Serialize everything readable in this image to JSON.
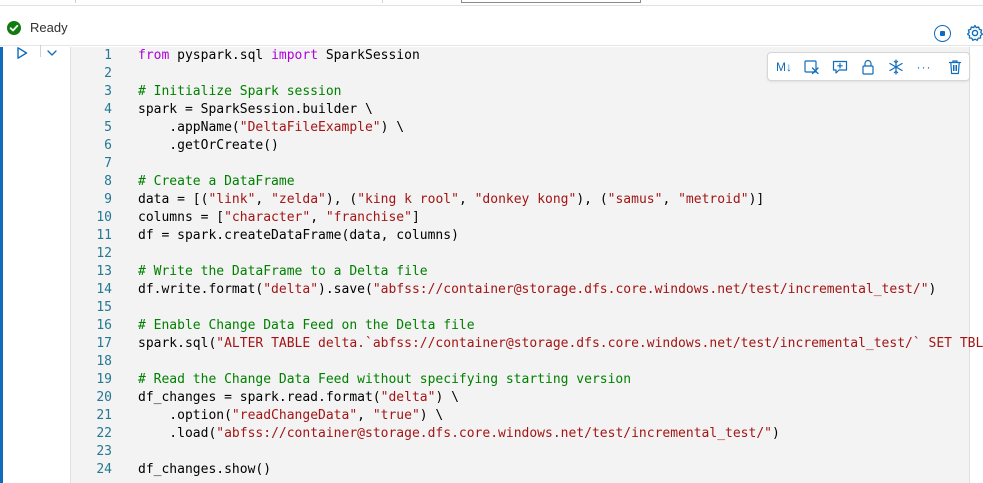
{
  "status": {
    "label": "Ready"
  },
  "toolbar": {
    "markdown_label": "M↓",
    "more_label": "···"
  },
  "editor": {
    "lines": [
      {
        "n": "1",
        "tokens": [
          {
            "t": "kw",
            "v": "from"
          },
          {
            "t": "tx",
            "v": " pyspark.sql "
          },
          {
            "t": "kw",
            "v": "import"
          },
          {
            "t": "tx",
            "v": " SparkSession"
          }
        ]
      },
      {
        "n": "2",
        "tokens": []
      },
      {
        "n": "3",
        "tokens": [
          {
            "t": "cm",
            "v": "# Initialize Spark session"
          }
        ]
      },
      {
        "n": "4",
        "tokens": [
          {
            "t": "tx",
            "v": "spark = SparkSession.builder \\"
          }
        ]
      },
      {
        "n": "5",
        "tokens": [
          {
            "t": "tx",
            "v": "    .appName("
          },
          {
            "t": "str",
            "v": "\"DeltaFileExample\""
          },
          {
            "t": "tx",
            "v": ") \\"
          }
        ]
      },
      {
        "n": "6",
        "tokens": [
          {
            "t": "tx",
            "v": "    .getOrCreate()"
          }
        ]
      },
      {
        "n": "7",
        "tokens": []
      },
      {
        "n": "8",
        "tokens": [
          {
            "t": "cm",
            "v": "# Create a DataFrame"
          }
        ]
      },
      {
        "n": "9",
        "tokens": [
          {
            "t": "tx",
            "v": "data = [("
          },
          {
            "t": "str",
            "v": "\"link\""
          },
          {
            "t": "tx",
            "v": ", "
          },
          {
            "t": "str",
            "v": "\"zelda\""
          },
          {
            "t": "tx",
            "v": "), ("
          },
          {
            "t": "str",
            "v": "\"king k rool\""
          },
          {
            "t": "tx",
            "v": ", "
          },
          {
            "t": "str",
            "v": "\"donkey kong\""
          },
          {
            "t": "tx",
            "v": "), ("
          },
          {
            "t": "str",
            "v": "\"samus\""
          },
          {
            "t": "tx",
            "v": ", "
          },
          {
            "t": "str",
            "v": "\"metroid\""
          },
          {
            "t": "tx",
            "v": ")]"
          }
        ]
      },
      {
        "n": "10",
        "tokens": [
          {
            "t": "tx",
            "v": "columns = ["
          },
          {
            "t": "str",
            "v": "\"character\""
          },
          {
            "t": "tx",
            "v": ", "
          },
          {
            "t": "str",
            "v": "\"franchise\""
          },
          {
            "t": "tx",
            "v": "]"
          }
        ]
      },
      {
        "n": "11",
        "tokens": [
          {
            "t": "tx",
            "v": "df = spark.createDataFrame(data, columns)"
          }
        ]
      },
      {
        "n": "12",
        "tokens": []
      },
      {
        "n": "13",
        "tokens": [
          {
            "t": "cm",
            "v": "# Write the DataFrame to a Delta file"
          }
        ]
      },
      {
        "n": "14",
        "tokens": [
          {
            "t": "tx",
            "v": "df.write.format("
          },
          {
            "t": "str",
            "v": "\"delta\""
          },
          {
            "t": "tx",
            "v": ").save("
          },
          {
            "t": "str",
            "v": "\"abfss://container@storage.dfs.core.windows.net/test/incremental_test/\""
          },
          {
            "t": "tx",
            "v": ")"
          }
        ]
      },
      {
        "n": "15",
        "tokens": []
      },
      {
        "n": "16",
        "tokens": [
          {
            "t": "cm",
            "v": "# Enable Change Data Feed on the Delta file"
          }
        ]
      },
      {
        "n": "17",
        "tokens": [
          {
            "t": "tx",
            "v": "spark.sql("
          },
          {
            "t": "str",
            "v": "\"ALTER TABLE delta.`abfss://container@storage.dfs.core.windows.net/test/incremental_test/` SET TBLPROPERTIES (delta.enableChangeDataFeed = true)\""
          },
          {
            "t": "tx",
            "v": ")"
          }
        ]
      },
      {
        "n": "18",
        "tokens": []
      },
      {
        "n": "19",
        "tokens": [
          {
            "t": "cm",
            "v": "# Read the Change Data Feed without specifying starting version"
          }
        ]
      },
      {
        "n": "20",
        "tokens": [
          {
            "t": "tx",
            "v": "df_changes = spark.read.format("
          },
          {
            "t": "str",
            "v": "\"delta\""
          },
          {
            "t": "tx",
            "v": ") \\"
          }
        ]
      },
      {
        "n": "21",
        "tokens": [
          {
            "t": "tx",
            "v": "    .option("
          },
          {
            "t": "str",
            "v": "\"readChangeData\""
          },
          {
            "t": "tx",
            "v": ", "
          },
          {
            "t": "str",
            "v": "\"true\""
          },
          {
            "t": "tx",
            "v": ") \\"
          }
        ]
      },
      {
        "n": "22",
        "tokens": [
          {
            "t": "tx",
            "v": "    .load("
          },
          {
            "t": "str",
            "v": "\"abfss://container@storage.dfs.core.windows.net/test/incremental_test/\""
          },
          {
            "t": "tx",
            "v": ")"
          }
        ]
      },
      {
        "n": "23",
        "tokens": []
      },
      {
        "n": "24",
        "tokens": [
          {
            "t": "tx",
            "v": "df_changes.show()"
          }
        ]
      }
    ]
  },
  "colors": {
    "accent": "#0f6cbd",
    "success": "#107c10",
    "keyword": "#af00db",
    "comment": "#008000",
    "string": "#a31515",
    "line_number": "#237893"
  }
}
